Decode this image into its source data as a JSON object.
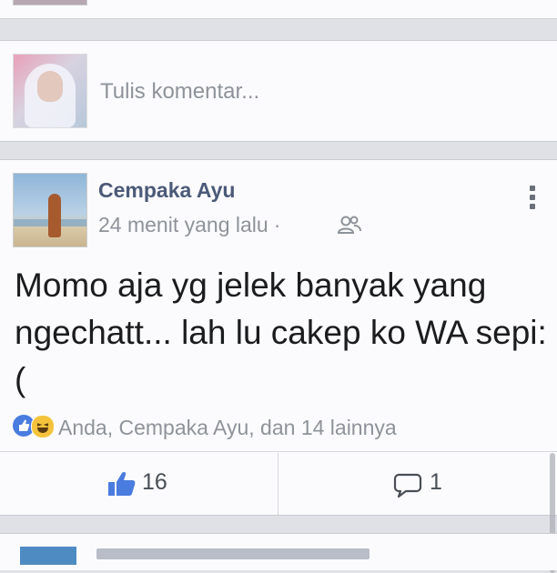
{
  "comment_box": {
    "placeholder": "Tulis komentar..."
  },
  "post": {
    "author": "Cempaka Ayu",
    "time": "24 menit yang lalu",
    "meta_separator": "·",
    "privacy_icon": "friends-icon",
    "text": "Momo aja yg jelek banyak yang ngechatt... lah lu cakep ko WA sepi:(",
    "reaction_icons": [
      "like-reaction-icon",
      "haha-reaction-icon"
    ],
    "reaction_summary": "Anda, Cempaka Ayu, dan 14 lainnya",
    "like_count": "16",
    "comment_count": "1"
  },
  "colors": {
    "author": "#4b5a78",
    "meta": "#8e939a",
    "like_blue": "#4a7ce0",
    "haha_yellow": "#f5c33b",
    "background": "#dfe1e6",
    "card": "#fbfbfd"
  }
}
